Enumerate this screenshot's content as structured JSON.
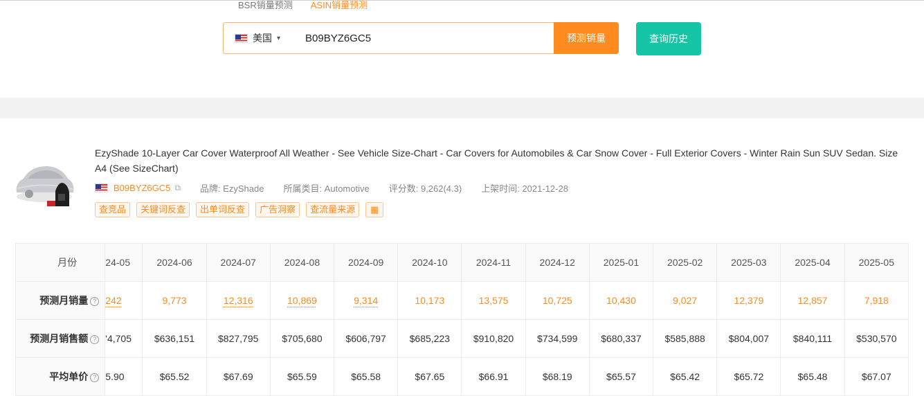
{
  "tabs": [
    {
      "label": "BSR销量预测",
      "active": false
    },
    {
      "label": "ASIN销量预测",
      "active": true
    }
  ],
  "search": {
    "country_label": "美国",
    "country_flag": "us-flag-icon",
    "value": "B09BYZ6GC5",
    "predict_label": "预测销量",
    "history_label": "查询历史"
  },
  "product": {
    "title": "EzyShade 10-Layer Car Cover Waterproof All Weather - See Vehicle Size-Chart - Car Covers for Automobiles & Car Snow Cover - Full Exterior Covers - Winter Rain Sun SUV Sedan. Size A4 (See SizeChart)",
    "asin": "B09BYZ6GC5",
    "brand": "品牌: EzyShade",
    "category": "所属类目: Automotive",
    "rating": "评分数: 9,262(4.3)",
    "launch": "上架时间: 2021-12-28",
    "actions": [
      "查竞品",
      "关键词反查",
      "出单词反查",
      "广告洞察",
      "查流量来源"
    ],
    "calc_icon": "calculator-icon"
  },
  "table": {
    "month_label": "月份",
    "sales_label": "预测月销量",
    "revenue_label": "预测月销售额",
    "price_label": "平均单价",
    "months": [
      "24-05",
      "2024-06",
      "2024-07",
      "2024-08",
      "2024-09",
      "2024-10",
      "2024-11",
      "2024-12",
      "2025-01",
      "2025-02",
      "2025-03",
      "2025-04",
      "2025-05"
    ],
    "sales": [
      "242",
      "9,773",
      "12,316",
      "10,869",
      "9,314",
      "10,173",
      "13,575",
      "10,725",
      "10,430",
      "9,027",
      "12,379",
      "12,857",
      "7,918"
    ],
    "revenue": [
      "'4,705",
      "$636,151",
      "$827,795",
      "$705,680",
      "$606,797",
      "$685,223",
      "$910,820",
      "$734,599",
      "$680,337",
      "$585,888",
      "$804,007",
      "$840,111",
      "$530,570"
    ],
    "price": [
      "5.90",
      "$65.52",
      "$67.69",
      "$65.59",
      "$65.58",
      "$67.65",
      "$66.91",
      "$68.19",
      "$65.57",
      "$65.42",
      "$65.72",
      "$65.48",
      "$67.07"
    ]
  },
  "colors": {
    "accent": "#ff8a1f",
    "history_button": "#15c5a5"
  }
}
